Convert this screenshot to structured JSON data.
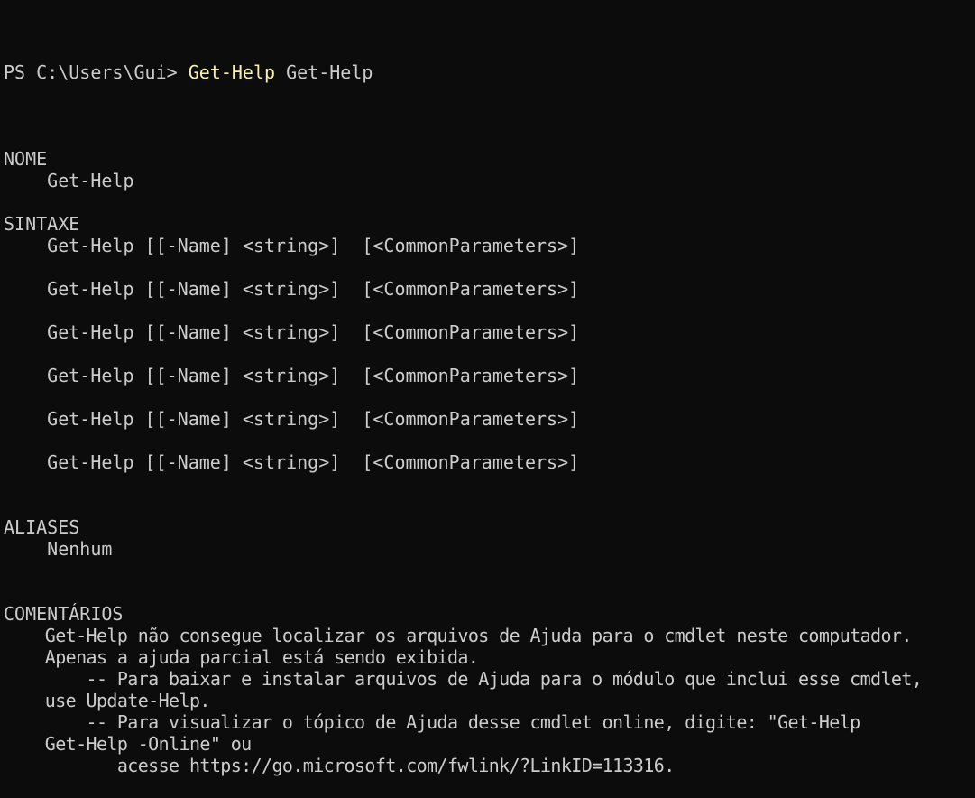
{
  "prompt": {
    "text": "PS C:\\Users\\Gui> ",
    "command": "Get-Help",
    "argument": " Get-Help"
  },
  "lines": [
    "",
    "NOME",
    "    Get-Help",
    "",
    "SINTAXE",
    "    Get-Help [[-Name] <string>]  [<CommonParameters>]",
    "",
    "    Get-Help [[-Name] <string>]  [<CommonParameters>]",
    "",
    "    Get-Help [[-Name] <string>]  [<CommonParameters>]",
    "",
    "    Get-Help [[-Name] <string>]  [<CommonParameters>]",
    "",
    "    Get-Help [[-Name] <string>]  [<CommonParameters>]",
    "",
    "    Get-Help [[-Name] <string>]  [<CommonParameters>]",
    "",
    "",
    "ALIASES",
    "    Nenhum",
    "",
    "",
    "COMENTÁRIOS",
    "    Get-Help não consegue localizar os arquivos de Ajuda para o cmdlet neste computador.",
    "    Apenas a ajuda parcial está sendo exibida.",
    "        -- Para baixar e instalar arquivos de Ajuda para o módulo que inclui esse cmdlet,",
    "    use Update-Help.",
    "        -- Para visualizar o tópico de Ajuda desse cmdlet online, digite: \"Get-Help",
    "    Get-Help -Online\" ou",
    "           acesse https://go.microsoft.com/fwlink/?LinkID=113316."
  ],
  "colors": {
    "background": "#0c0c0c",
    "foreground": "#cccccc",
    "command": "#f9f1a5"
  }
}
